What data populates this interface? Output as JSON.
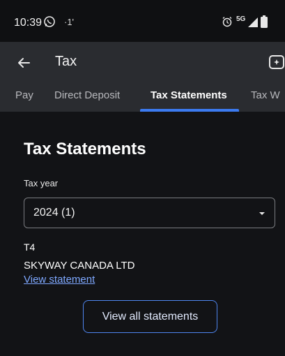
{
  "status_bar": {
    "time": "10:39",
    "extra": "·1'",
    "network": "5G",
    "icons": [
      "whatsapp-icon",
      "alarm-icon",
      "signal-icon",
      "battery-icon"
    ]
  },
  "app_bar": {
    "title": "Tax",
    "back_icon": "arrow-left-icon",
    "action_icon": "chat-icon"
  },
  "tabs": [
    {
      "label": "Pay",
      "active": false
    },
    {
      "label": "Direct Deposit",
      "active": false
    },
    {
      "label": "Tax Statements",
      "active": true
    },
    {
      "label": "Tax W",
      "active": false
    }
  ],
  "main": {
    "section_title": "Tax Statements",
    "tax_year": {
      "label": "Tax year",
      "value": "2024 (1)"
    },
    "statement": {
      "type": "T4",
      "employer": "SKYWAY CANADA LTD",
      "link": "View statement"
    },
    "view_all_button": "View all statements"
  },
  "colors": {
    "background": "#121316",
    "app_bar": "#2a2c30",
    "accent": "#3c7bf0",
    "link": "#7ea8ff"
  }
}
